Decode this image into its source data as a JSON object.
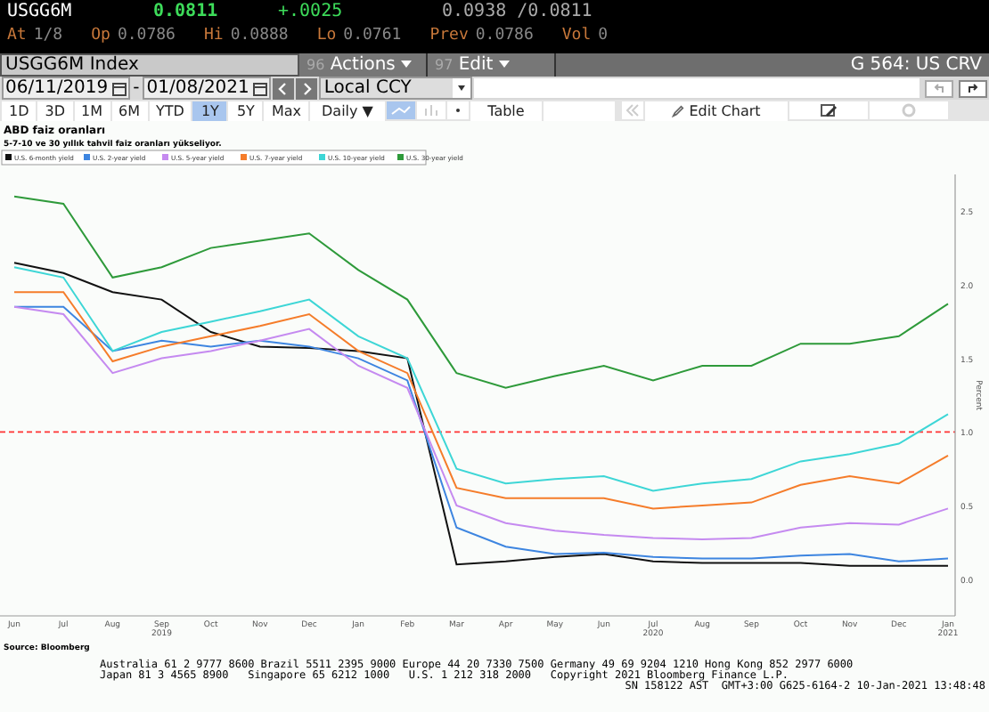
{
  "quote": {
    "ticker": "USGG6M",
    "price": "0.0811",
    "change": "+.0025",
    "bid_ask": "0.0938 /0.0811",
    "fields": [
      {
        "label": "At",
        "value": "1/8"
      },
      {
        "label": "Op",
        "value": "0.0786"
      },
      {
        "label": "Hi",
        "value": "0.0888"
      },
      {
        "label": "Lo",
        "value": "0.0761"
      },
      {
        "label": "Prev",
        "value": "0.0786"
      },
      {
        "label": "Vol",
        "value": "0"
      }
    ]
  },
  "command_bar": {
    "security": "USGG6M Index",
    "menus": [
      {
        "number": "96",
        "label": "Actions"
      },
      {
        "number": "97",
        "label": "Edit"
      }
    ],
    "page": "G 564: US CRV"
  },
  "date_bar": {
    "start": "06/11/2019",
    "separator": "-",
    "end": "01/08/2021",
    "currency": "Local CCY"
  },
  "periods": [
    {
      "label": "1D",
      "selected": false
    },
    {
      "label": "3D",
      "selected": false
    },
    {
      "label": "1M",
      "selected": false
    },
    {
      "label": "6M",
      "selected": false
    },
    {
      "label": "YTD",
      "selected": false
    },
    {
      "label": "1Y",
      "selected": true
    },
    {
      "label": "5Y",
      "selected": false
    },
    {
      "label": "Max",
      "selected": false
    }
  ],
  "frequency": "Daily ▼",
  "table_button": "Table",
  "edit_chart_button": "Edit Chart",
  "chart_data": {
    "type": "line",
    "title": "ABD faiz oranları",
    "subtitle": "5-7-10 ve 30 yıllık tahvil faiz oranları yükseliyor.",
    "ylabel": "Percent",
    "categories": [
      "Jun",
      "Jul",
      "Aug",
      "Sep",
      "Oct",
      "Nov",
      "Dec",
      "Jan",
      "Feb",
      "Mar",
      "Apr",
      "May",
      "Jun",
      "Jul",
      "Aug",
      "Sep",
      "Oct",
      "Nov",
      "Dec",
      "Jan"
    ],
    "legend": "top",
    "ylim": [
      -0.25,
      2.75
    ],
    "yticks": [
      {
        "value": 0,
        "label": "0.0"
      },
      {
        "value": 0.5,
        "label": "0.5"
      },
      {
        "value": 1,
        "label": "1.0"
      },
      {
        "value": 1.5,
        "label": "1.5"
      },
      {
        "value": 2,
        "label": "2.0"
      },
      {
        "value": 2.5,
        "label": "2.5"
      }
    ],
    "ref_lines": [
      {
        "axis": "y",
        "value": 1,
        "color": "#ff3333"
      }
    ],
    "series": [
      {
        "name": "U.S. 6-month yield",
        "color": "#111111",
        "values": [
          2.15,
          2.08,
          1.95,
          1.9,
          1.68,
          1.58,
          1.57,
          1.55,
          1.5,
          0.1,
          0.12,
          0.15,
          0.17,
          0.12,
          0.11,
          0.11,
          0.11,
          0.09,
          0.09,
          0.09
        ]
      },
      {
        "name": "U.S. 2-year yield",
        "color": "#3d85e0",
        "values": [
          1.85,
          1.85,
          1.55,
          1.62,
          1.58,
          1.62,
          1.58,
          1.5,
          1.35,
          0.35,
          0.22,
          0.17,
          0.18,
          0.15,
          0.14,
          0.14,
          0.16,
          0.17,
          0.12,
          0.14
        ]
      },
      {
        "name": "U.S. 5-year yield",
        "color": "#c58af0",
        "values": [
          1.85,
          1.8,
          1.4,
          1.5,
          1.55,
          1.62,
          1.7,
          1.45,
          1.3,
          0.5,
          0.38,
          0.33,
          0.3,
          0.28,
          0.27,
          0.28,
          0.35,
          0.38,
          0.37,
          0.48
        ]
      },
      {
        "name": "U.S. 7-year yield",
        "color": "#f57c2a",
        "values": [
          1.95,
          1.95,
          1.48,
          1.58,
          1.65,
          1.72,
          1.8,
          1.55,
          1.4,
          0.62,
          0.55,
          0.55,
          0.55,
          0.48,
          0.5,
          0.52,
          0.64,
          0.7,
          0.65,
          0.84
        ]
      },
      {
        "name": "U.S. 10-year yield",
        "color": "#3dd6d6",
        "values": [
          2.12,
          2.05,
          1.55,
          1.68,
          1.75,
          1.82,
          1.9,
          1.65,
          1.5,
          0.75,
          0.65,
          0.68,
          0.7,
          0.6,
          0.65,
          0.68,
          0.8,
          0.85,
          0.92,
          1.12
        ]
      },
      {
        "name": "U.S. 30-year yield",
        "color": "#2e9a3a",
        "values": [
          2.6,
          2.55,
          2.05,
          2.12,
          2.25,
          2.3,
          2.35,
          2.1,
          1.9,
          1.4,
          1.3,
          1.38,
          1.45,
          1.35,
          1.45,
          1.45,
          1.6,
          1.6,
          1.65,
          1.87
        ]
      }
    ]
  },
  "timeline_years": [
    "2019",
    "2020",
    "2021"
  ],
  "footer": {
    "source": "Source: Bloomberg",
    "lines": [
      "Australia 61 2 9777 8600 Brazil 5511 2395 9000 Europe 44 20 7330 7500 Germany 49 69 9204 1210 Hong Kong 852 2977 6000",
      "Japan 81 3 4565 8900   Singapore 65 6212 1000   U.S. 1 212 318 2000   Copyright 2021 Bloomberg Finance L.P.",
      "SN 158122 AST  GMT+3:00 G625-6164-2 10-Jan-2021 13:48:48"
    ]
  }
}
